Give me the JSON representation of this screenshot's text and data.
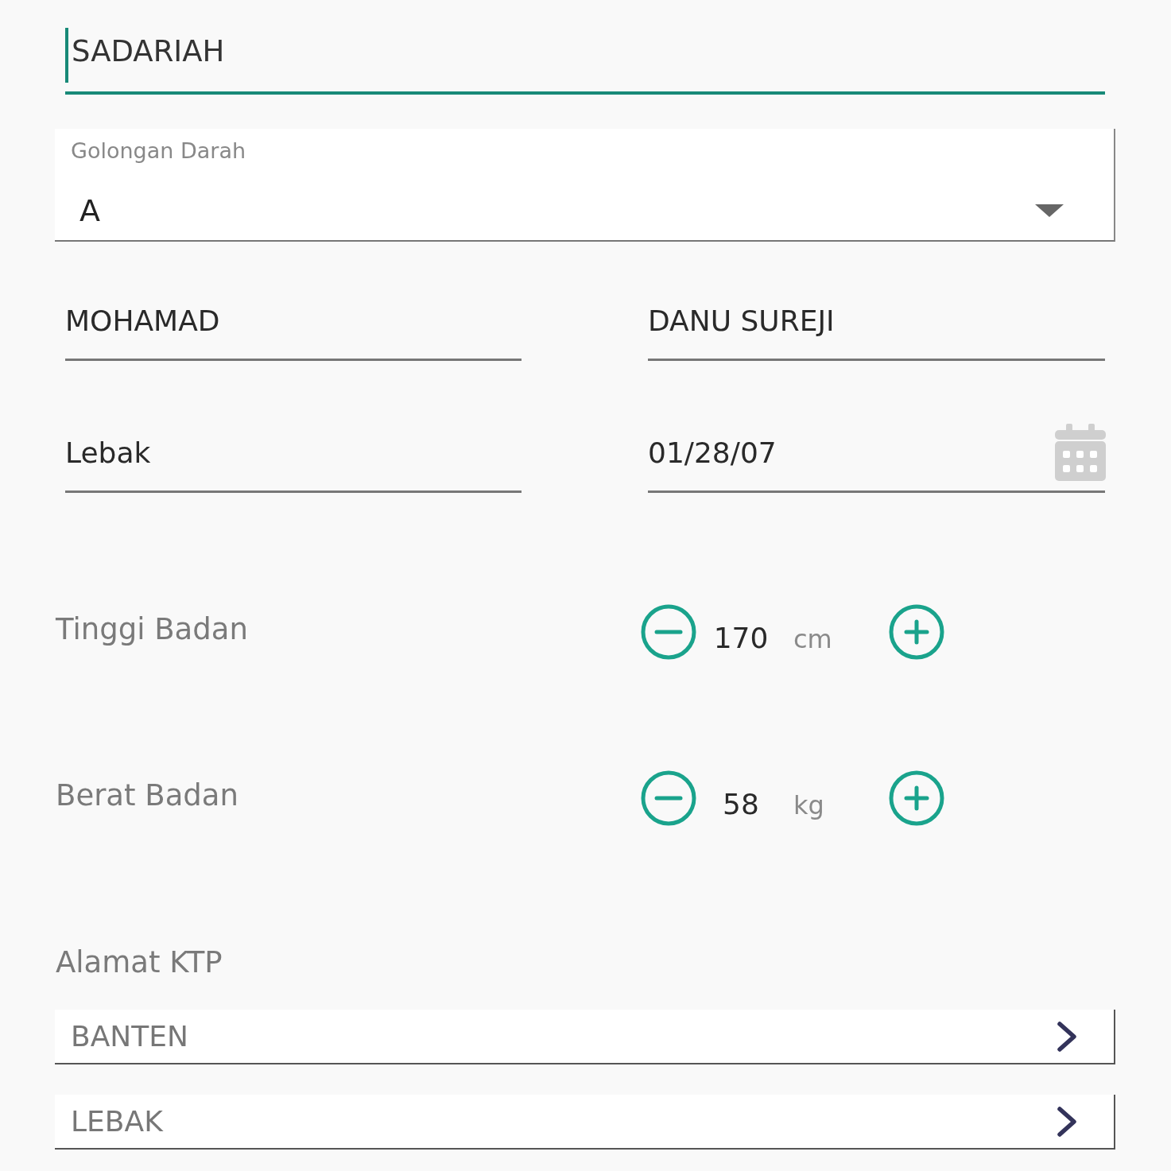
{
  "name_field": {
    "value": "SADARIAH",
    "focused": true
  },
  "blood_type": {
    "label": "Golongan Darah",
    "value": "A"
  },
  "fields": [
    {
      "kind": "text",
      "value": "MOHAMAD"
    },
    {
      "kind": "text",
      "value": "DANU SUREJI"
    },
    {
      "kind": "text",
      "value": "Lebak"
    },
    {
      "kind": "date",
      "value": "01/28/07"
    }
  ],
  "measurements": [
    {
      "label": "Tinggi Badan",
      "value": "170",
      "unit": "cm"
    },
    {
      "label": "Berat Badan",
      "value": "58",
      "unit": "kg"
    }
  ],
  "address": {
    "title": "Alamat KTP",
    "items": [
      {
        "value": "BANTEN"
      },
      {
        "value": "LEBAK"
      }
    ]
  }
}
